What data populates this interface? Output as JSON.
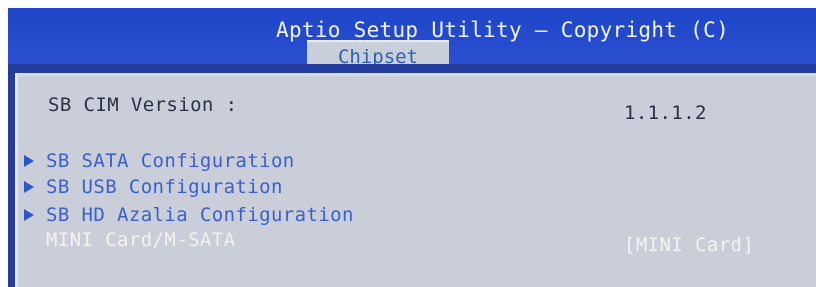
{
  "header": {
    "title": "Aptio Setup Utility – Copyright (C)",
    "active_tab": "Chipset"
  },
  "main": {
    "sb_cim_version": {
      "label": "SB CIM Version :",
      "value": "1.1.1.2"
    },
    "submenus": [
      {
        "label": "SB SATA Configuration",
        "icon": "triangle-right-icon"
      },
      {
        "label": "SB USB Configuration",
        "icon": "triangle-right-icon"
      },
      {
        "label": "SB HD Azalia Configuration",
        "icon": "triangle-right-icon"
      }
    ],
    "mini_card": {
      "label": "MINI Card/M-SATA",
      "value": "[MINI Card]"
    }
  },
  "colors": {
    "header_blue": "#2a4fd0",
    "panel_gray": "#c9ced9",
    "submenu_blue": "#3b5fcf",
    "highlight_text": "#f2f2ef"
  }
}
